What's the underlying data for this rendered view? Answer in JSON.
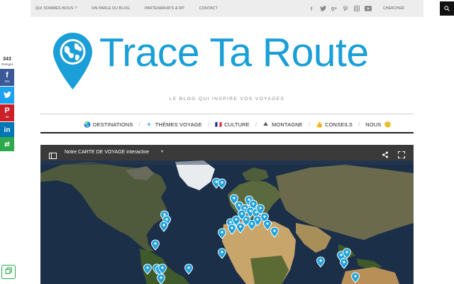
{
  "topbar": {
    "nav": [
      "QUI SOMMES-NOUS ?",
      "ON PARLE DU BLOG",
      "PARTENARIATS & RP",
      "CONTACT"
    ],
    "social_icons": [
      "facebook-icon",
      "twitter-icon",
      "google-plus-icon",
      "pinterest-icon",
      "instagram-icon",
      "youtube-icon"
    ],
    "search_label": "CHERCHER"
  },
  "logo": {
    "title": "Trace Ta Route",
    "tagline": "LE BLOG QUI INSPIRE VOS VOYAGES",
    "brand_color": "#1a9fd8"
  },
  "mainnav": [
    {
      "icon": "globe-icon",
      "glyph": "🌏",
      "label": "DESTINATIONS"
    },
    {
      "icon": "airplane-icon",
      "glyph": "✈",
      "label": "THÈMES VOYAGE"
    },
    {
      "icon": "flag-icon",
      "glyph": "🇫🇷",
      "label": "CULTURE"
    },
    {
      "icon": "mountain-icon",
      "glyph": "⛰",
      "label": "MONTAGNE"
    },
    {
      "icon": "thumbs-up-icon",
      "glyph": "👍",
      "label": "CONSEILS"
    },
    {
      "icon": "smiley-icon",
      "glyph": "🙂",
      "label": "NOUS"
    }
  ],
  "share": {
    "total": "343",
    "label": "Partages",
    "buttons": [
      {
        "name": "facebook",
        "glyph": "f",
        "count": "311",
        "color": "#3b5998"
      },
      {
        "name": "twitter",
        "glyph": "t",
        "count": "",
        "color": "#1da1f2"
      },
      {
        "name": "pinterest",
        "glyph": "P",
        "count": "32",
        "color": "#cb2027"
      },
      {
        "name": "linkedin",
        "glyph": "in",
        "count": "",
        "color": "#0077b5"
      },
      {
        "name": "more",
        "glyph": "⇄",
        "count": "",
        "color": "#2da84a"
      }
    ]
  },
  "map": {
    "title": "Notre CARTE DE VOYAGE interactive",
    "marker_color": "#1ea3dc"
  }
}
